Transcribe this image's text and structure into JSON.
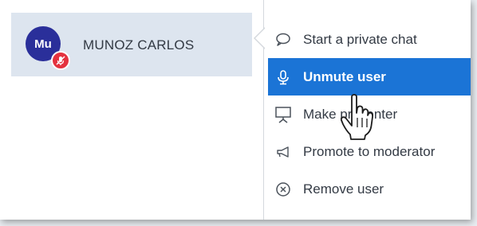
{
  "user": {
    "initials": "Mu",
    "name": "MUNOZ CARLOS"
  },
  "menu": {
    "items": [
      {
        "label": "Start a private chat",
        "icon": "chat-bubble-icon",
        "active": false
      },
      {
        "label": "Unmute user",
        "icon": "microphone-icon",
        "active": true
      },
      {
        "label": "Make presenter",
        "icon": "presentation-icon",
        "active": false
      },
      {
        "label": "Promote to moderator",
        "icon": "megaphone-icon",
        "active": false
      },
      {
        "label": "Remove user",
        "icon": "remove-circle-icon",
        "active": false
      }
    ]
  },
  "colors": {
    "accent": "#1b74d6",
    "avatar": "#2a2f9a",
    "muted_badge": "#e4323f",
    "selected_row": "#dde5ef"
  }
}
